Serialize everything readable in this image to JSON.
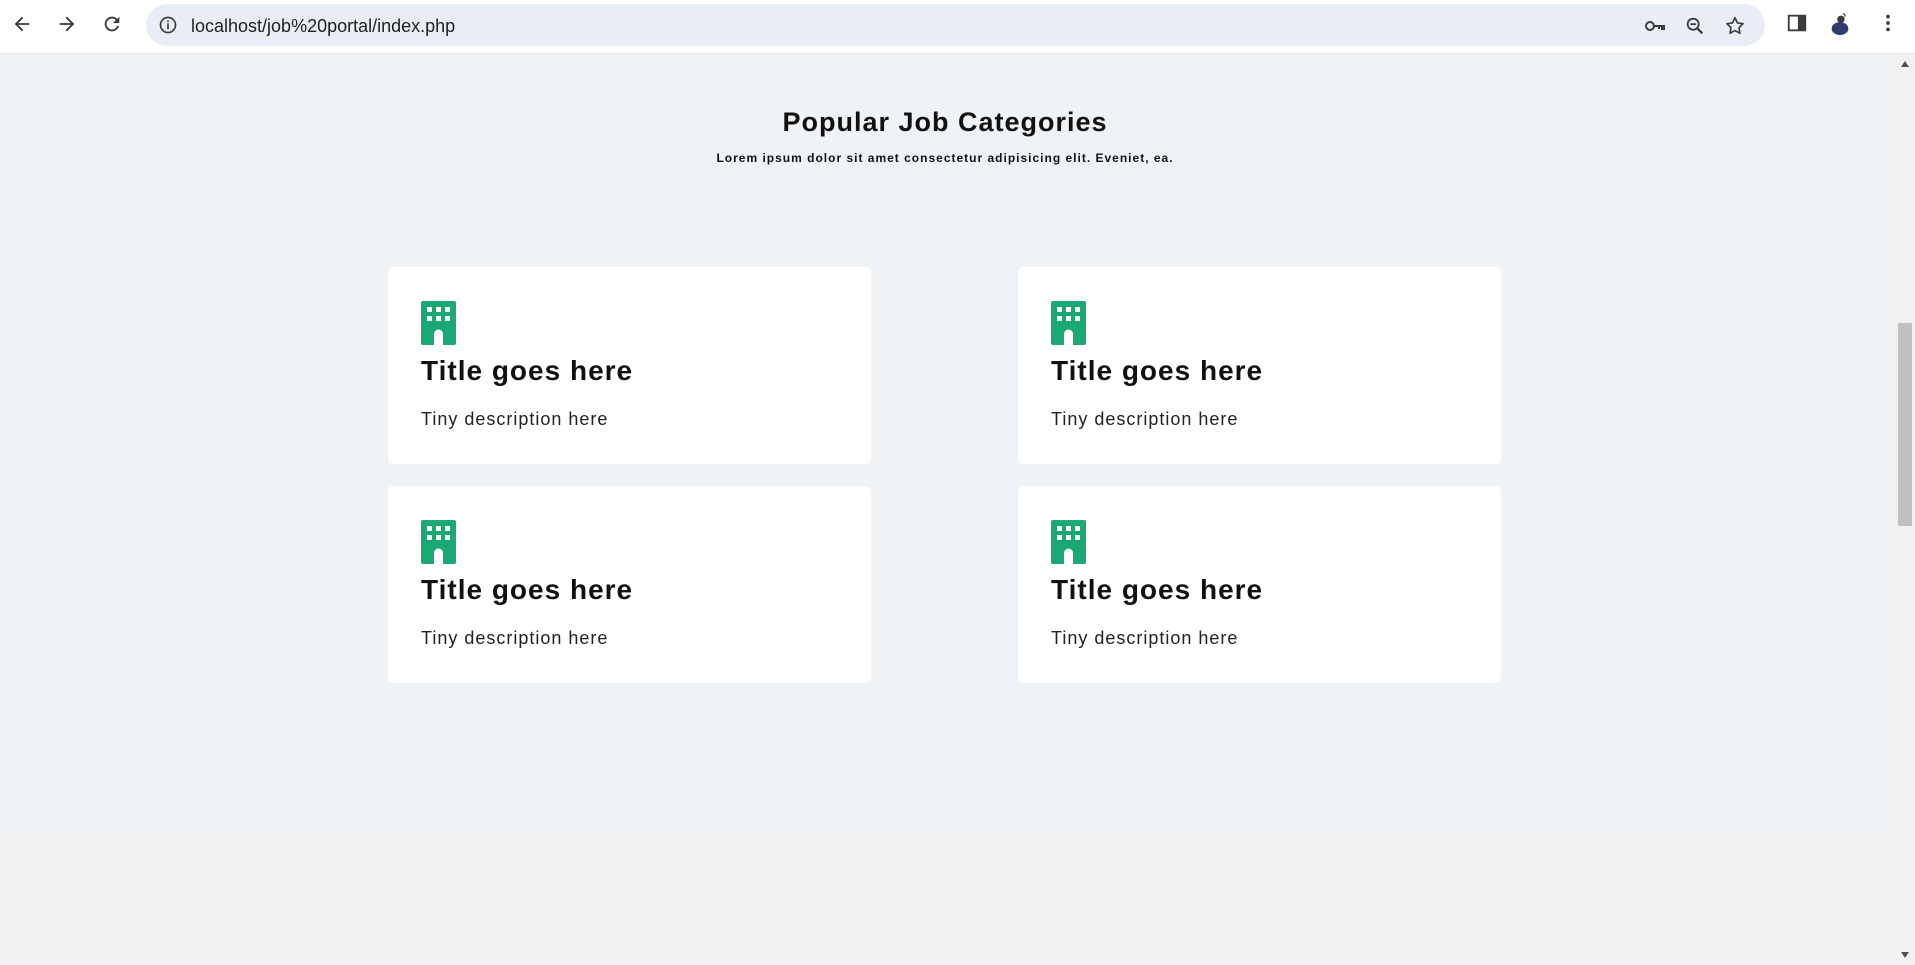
{
  "browser": {
    "url": "localhost/job%20portal/index.php"
  },
  "section": {
    "heading": "Popular Job Categories",
    "subheading": "Lorem ipsum dolor sit amet consectetur adipisicing elit. Eveniet, ea."
  },
  "cards": [
    {
      "title": "Title goes here",
      "description": "Tiny description here"
    },
    {
      "title": "Title goes here",
      "description": "Tiny description here"
    },
    {
      "title": "Title goes here",
      "description": "Tiny description here"
    },
    {
      "title": "Title goes here",
      "description": "Tiny description here"
    }
  ],
  "colors": {
    "accent": "#1aa874",
    "section_bg": "#f0f3f6",
    "card_bg": "#ffffff",
    "omnibox_bg": "#e9edf6"
  },
  "icons": {
    "card_icon": "building-icon"
  }
}
